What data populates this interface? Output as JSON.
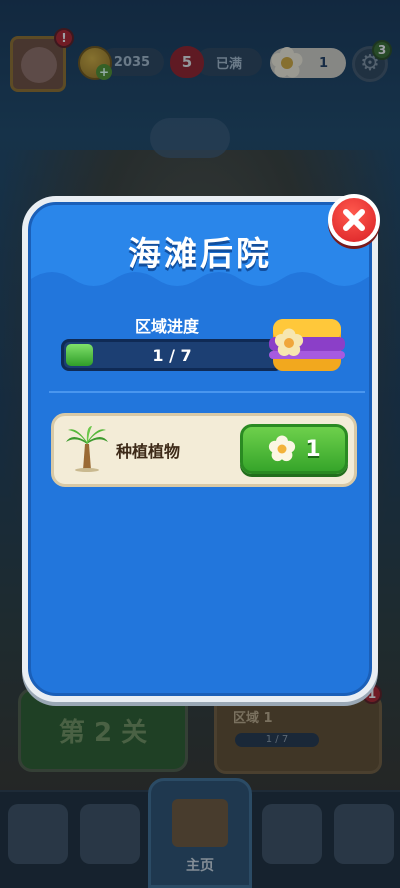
{
  "hud": {
    "avatar_badge": "!",
    "coins": "2035",
    "lives_count": "5",
    "lives_status": "已满",
    "flowers": "1",
    "settings_badge": "3"
  },
  "modal": {
    "title": "海滩后院",
    "progress_label": "区域进度",
    "progress_text": "1 / 7",
    "progress_fraction": 0.1428,
    "task": {
      "label": "种植植物",
      "cost": "1"
    }
  },
  "background": {
    "level_button": "第 2 关",
    "area_card_title": "区域 1",
    "area_card_progress": "1 / 7",
    "area_card_badge": "1",
    "nav_home_label": "主页"
  },
  "icons": {
    "close": "close-icon",
    "flower": "flower-icon",
    "palm": "palm-tree-icon",
    "chest": "treasure-chest-icon",
    "gear": "gear-icon",
    "coin": "coin-icon",
    "heart": "heart-icon"
  },
  "colors": {
    "modal_blue": "#2276dc",
    "title_blue": "#124f9e",
    "button_green": "#36a52a",
    "close_red": "#d81e24",
    "cream": "#f3ecd7"
  }
}
